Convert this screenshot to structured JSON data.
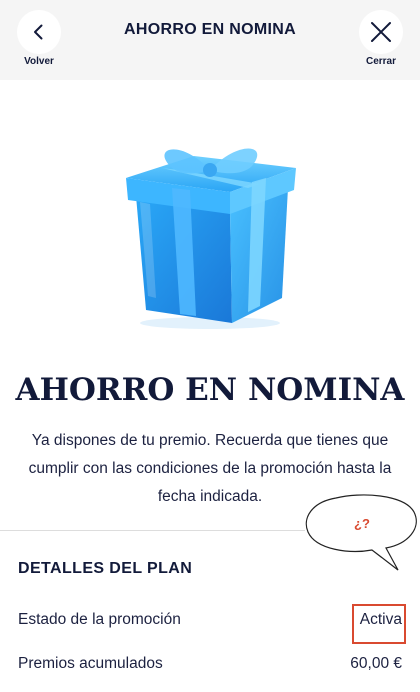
{
  "header": {
    "title": "AHORRO EN NOMINA",
    "back_label": "Volver",
    "close_label": "Cerrar"
  },
  "hero": {
    "title": "AHORRO EN NOMINA",
    "description": "Ya dispones de tu premio. Recuerda que tienes que cumplir con las condiciones de la promoción hasta la fecha indicada."
  },
  "annotation": {
    "bubble_text": "¿?"
  },
  "plan_details": {
    "title": "DETALLES DEL PLAN",
    "rows": [
      {
        "label": "Estado de la promoción",
        "value": "Activa"
      },
      {
        "label": "Premios acumulados",
        "value": "60,00 €"
      }
    ]
  },
  "colors": {
    "primary_text": "#121a3a",
    "header_bg": "#f5f5f5",
    "gift_blue": "#1e9bf0",
    "highlight_red": "#d94a30"
  }
}
